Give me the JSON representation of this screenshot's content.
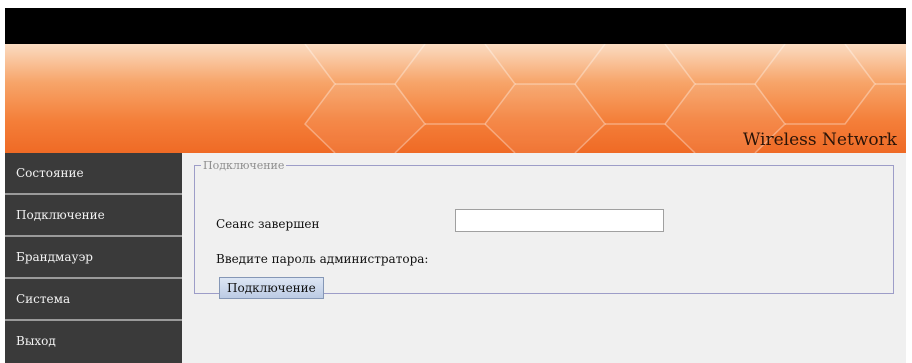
{
  "header": {
    "brand": "Wireless Network"
  },
  "sidebar": {
    "items": [
      {
        "label": "Состояние"
      },
      {
        "label": "Подключение"
      },
      {
        "label": "Брандмауэр"
      },
      {
        "label": "Система"
      },
      {
        "label": "Выход"
      }
    ]
  },
  "main": {
    "legend": "Подключение",
    "session_text": "Сеанс завершен",
    "password_prompt": "Введите пароль администратора:",
    "password_value": "",
    "connect_button": "Подключение"
  },
  "colors": {
    "topbar": "#000000",
    "banner_orange": "#f47f3a",
    "sidebar": "#3a3a3a",
    "content_bg": "#f0f0f0",
    "fieldset_border": "#9d9dc8"
  }
}
